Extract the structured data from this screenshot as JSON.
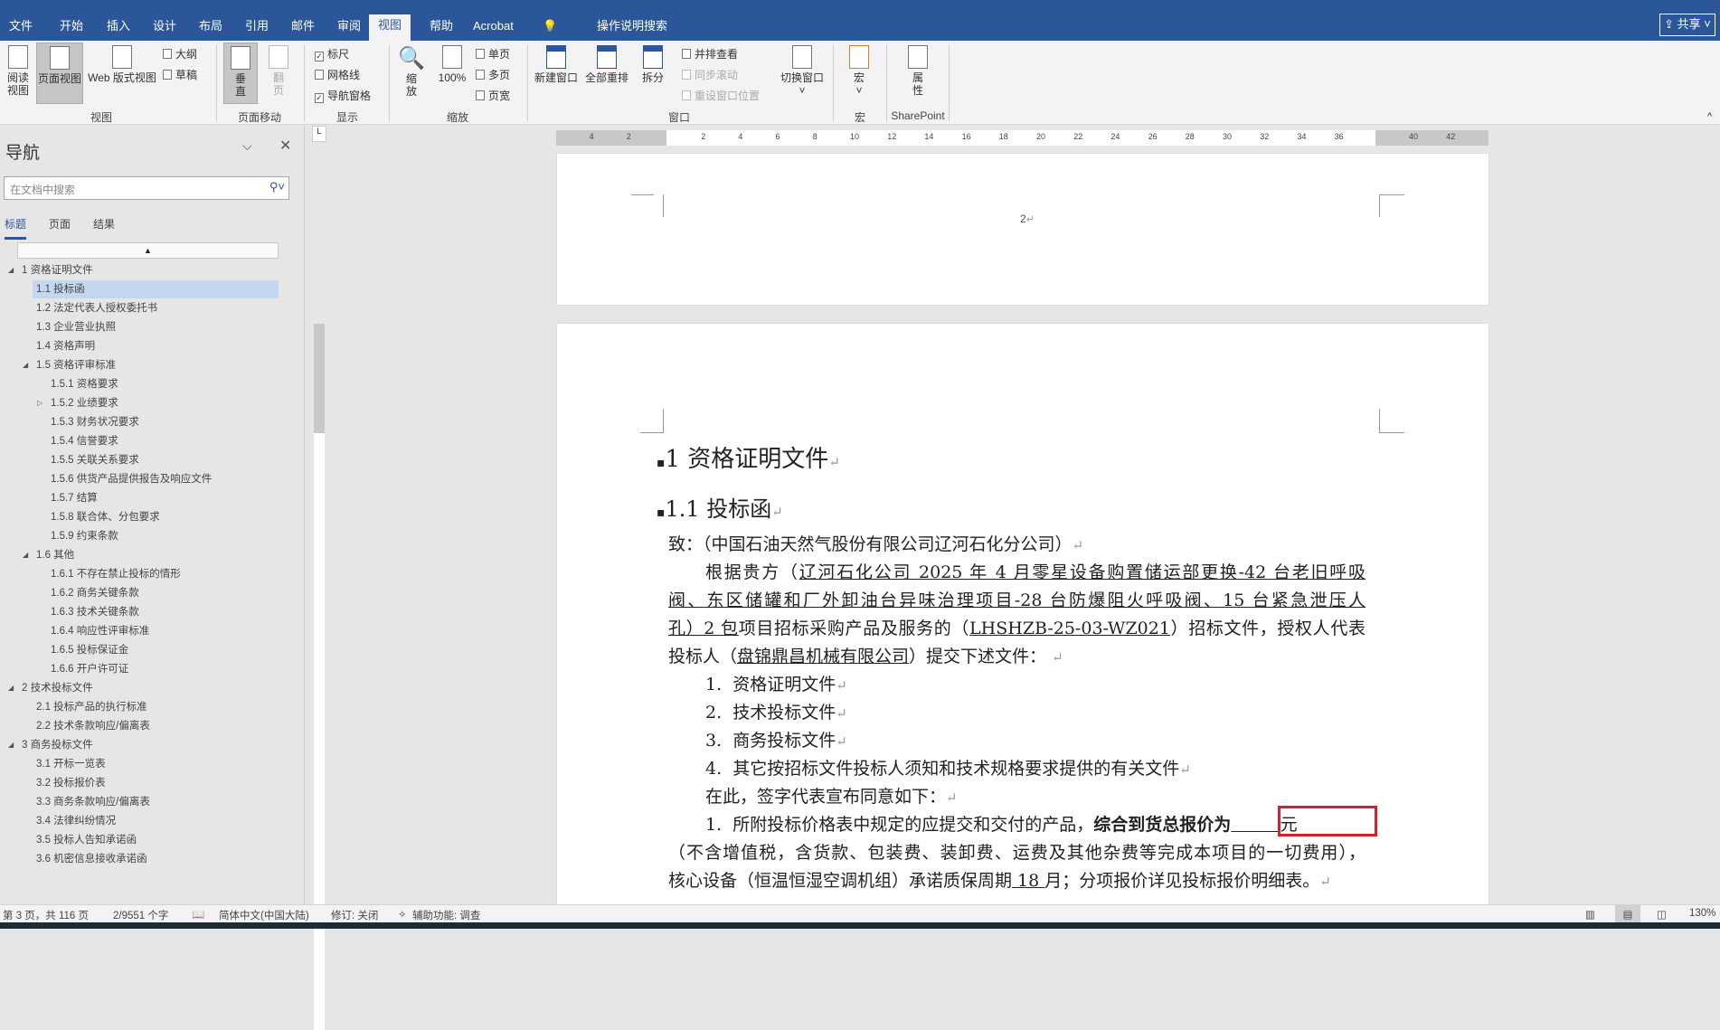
{
  "tabs": [
    {
      "label": "文件"
    },
    {
      "label": "开始"
    },
    {
      "label": "插入"
    },
    {
      "label": "设计"
    },
    {
      "label": "布局"
    },
    {
      "label": "引用"
    },
    {
      "label": "邮件"
    },
    {
      "label": "审阅"
    },
    {
      "label": "视图",
      "active": true
    },
    {
      "label": "帮助"
    },
    {
      "label": "Acrobat"
    }
  ],
  "tell_me": "操作说明搜索",
  "share_label": "共享",
  "ribbon": {
    "groups": [
      "视图",
      "页面移动",
      "显示",
      "缩放",
      "窗口",
      "宏",
      "SharePoint"
    ],
    "read_mode": "阅读\n视图",
    "print_layout": "页面视图",
    "web_layout": "Web 版式视图",
    "outline": "大纲",
    "draft": "草稿",
    "vertical": "垂\n直",
    "side_to_side": "翻\n页",
    "ruler": "标尺",
    "gridlines": "网格线",
    "nav_pane": "导航窗格",
    "zoom": "缩\n放",
    "zoom100": "100%",
    "one_page": "单页",
    "multi_page": "多页",
    "page_width": "页宽",
    "new_window": "新建窗口",
    "arrange_all": "全部重排",
    "split": "拆分",
    "side_by_side": "并排查看",
    "sync_scroll": "同步滚动",
    "reset_window": "重设窗口位置",
    "switch_windows": "切换窗口",
    "macros": "宏",
    "properties": "属\n性"
  },
  "nav": {
    "title": "导航",
    "search_placeholder": "在文档中搜索",
    "tabs": [
      "标题",
      "页面",
      "结果"
    ],
    "tree": [
      {
        "t": "1 资格证明文件",
        "l": 0,
        "tw": "open"
      },
      {
        "t": "1.1 投标函",
        "l": 1,
        "sel": true
      },
      {
        "t": "1.2 法定代表人授权委托书",
        "l": 1
      },
      {
        "t": "1.3 企业营业执照",
        "l": 1
      },
      {
        "t": "1.4 资格声明",
        "l": 1
      },
      {
        "t": "1.5 资格评审标准",
        "l": 1,
        "tw": "open"
      },
      {
        "t": "1.5.1 资格要求",
        "l": 2
      },
      {
        "t": "1.5.2 业绩要求",
        "l": 2,
        "tw": "closed"
      },
      {
        "t": "1.5.3 财务状况要求",
        "l": 2
      },
      {
        "t": "1.5.4 信誉要求",
        "l": 2
      },
      {
        "t": "1.5.5 关联关系要求",
        "l": 2
      },
      {
        "t": "1.5.6 供货产品提供报告及响应文件",
        "l": 2
      },
      {
        "t": "1.5.7 结算",
        "l": 2
      },
      {
        "t": "1.5.8 联合体、分包要求",
        "l": 2
      },
      {
        "t": "1.5.9 约束条款",
        "l": 2
      },
      {
        "t": "1.6 其他",
        "l": 1,
        "tw": "open"
      },
      {
        "t": "1.6.1 不存在禁止投标的情形",
        "l": 2
      },
      {
        "t": "1.6.2 商务关键条款",
        "l": 2
      },
      {
        "t": "1.6.3 技术关键条款",
        "l": 2
      },
      {
        "t": "1.6.4 响应性评审标准",
        "l": 2
      },
      {
        "t": "1.6.5 投标保证金",
        "l": 2
      },
      {
        "t": "1.6.6 开户许可证",
        "l": 2
      },
      {
        "t": "2 技术投标文件",
        "l": 0,
        "tw": "open"
      },
      {
        "t": "2.1 投标产品的执行标准",
        "l": 1
      },
      {
        "t": "2.2 技术条款响应/偏离表",
        "l": 1
      },
      {
        "t": "3 商务投标文件",
        "l": 0,
        "tw": "open"
      },
      {
        "t": "3.1 开标一览表",
        "l": 1
      },
      {
        "t": "3.2 投标报价表",
        "l": 1
      },
      {
        "t": "3.3 商务条款响应/偏离表",
        "l": 1
      },
      {
        "t": "3.4 法律纠纷情况",
        "l": 1
      },
      {
        "t": "3.5 投标人告知承诺函",
        "l": 1
      },
      {
        "t": "3.6 机密信息接收承诺函",
        "l": 1
      }
    ]
  },
  "ruler_ticks": [
    "4",
    "2",
    "2",
    "4",
    "6",
    "8",
    "10",
    "12",
    "14",
    "16",
    "18",
    "20",
    "22",
    "24",
    "26",
    "28",
    "30",
    "32",
    "34",
    "36",
    "40",
    "42"
  ],
  "document": {
    "prev_page_number": "2",
    "heading1": "1   资格证明文件",
    "heading2": "1.1 投标函",
    "lines": [
      {
        "s": [
          {
            "t": "致：（中国石油天然气股份有限公司辽河石化分公司）"
          }
        ],
        "pm": true
      },
      {
        "ind": true,
        "j": true,
        "s": [
          {
            "t": "根据贵方（"
          },
          {
            "t": "辽河石化公司 2025 年 4 月零星设备购置储运部更换-42 台老旧呼吸",
            "u": true
          }
        ]
      },
      {
        "j": true,
        "s": [
          {
            "t": "阀、东区储罐和厂外卸油台异味治理项目-28 台防爆阻火呼吸阀、15 台紧急泄压人",
            "u": true
          }
        ]
      },
      {
        "j": true,
        "s": [
          {
            "t": "孔）2 包",
            "u": true
          },
          {
            "t": "项目招标采购产品及服务的（"
          },
          {
            "t": "LHSHZB-25-03-WZ021",
            "u": true
          },
          {
            "t": "）招标文件，授权人代表"
          }
        ]
      },
      {
        "s": [
          {
            "t": "投标人（"
          },
          {
            "t": "盘锦鼎昌机械有限公司",
            "u": true
          },
          {
            "t": "）提交下述文件： "
          }
        ],
        "pm": true
      },
      {
        "ind": true,
        "s": [
          {
            "t": "1.  资格证明文件"
          }
        ],
        "pm": true
      },
      {
        "ind": true,
        "s": [
          {
            "t": "2.  技术投标文件"
          }
        ],
        "pm": true
      },
      {
        "ind": true,
        "s": [
          {
            "t": "3.  商务投标文件"
          }
        ],
        "pm": true
      },
      {
        "ind": true,
        "s": [
          {
            "t": "4.  其它按招标文件投标人须知和技术规格要求提供的有关文件"
          }
        ],
        "pm": true
      },
      {
        "ind": true,
        "s": [
          {
            "t": "在此，签字代表宣布同意如下："
          }
        ],
        "pm": true
      },
      {
        "ind": true,
        "s": [
          {
            "t": "1.  所附投标价格表中规定的应提交和交付的产品，"
          },
          {
            "t": "综合到货总报价为",
            "b": true
          },
          {
            "t": "         ",
            "u": true
          },
          {
            "t": "元"
          }
        ]
      },
      {
        "j": true,
        "s": [
          {
            "t": "（不含增值税，含货款、包装费、装卸费、运费及其他杂费等完成本项目的一切费用），"
          }
        ]
      },
      {
        "s": [
          {
            "t": "核心设备（恒温恒湿空调机组）承诺质保周期"
          },
          {
            "t": " 18 ",
            "u": true
          },
          {
            "t": "月；分项报价详见投标报价明细表。"
          }
        ],
        "pm": true
      }
    ],
    "paragraph_mark": "↵",
    "highlight_color": "#d6202e"
  },
  "status": {
    "page": "第 3 页，共 116 页",
    "words": "2/9551 个字",
    "language": "简体中文(中国大陆)",
    "track": "修订: 关闭",
    "accessibility": "辅助功能: 调查",
    "zoom": "130%"
  },
  "colors": {
    "brand": "#2b579a"
  }
}
